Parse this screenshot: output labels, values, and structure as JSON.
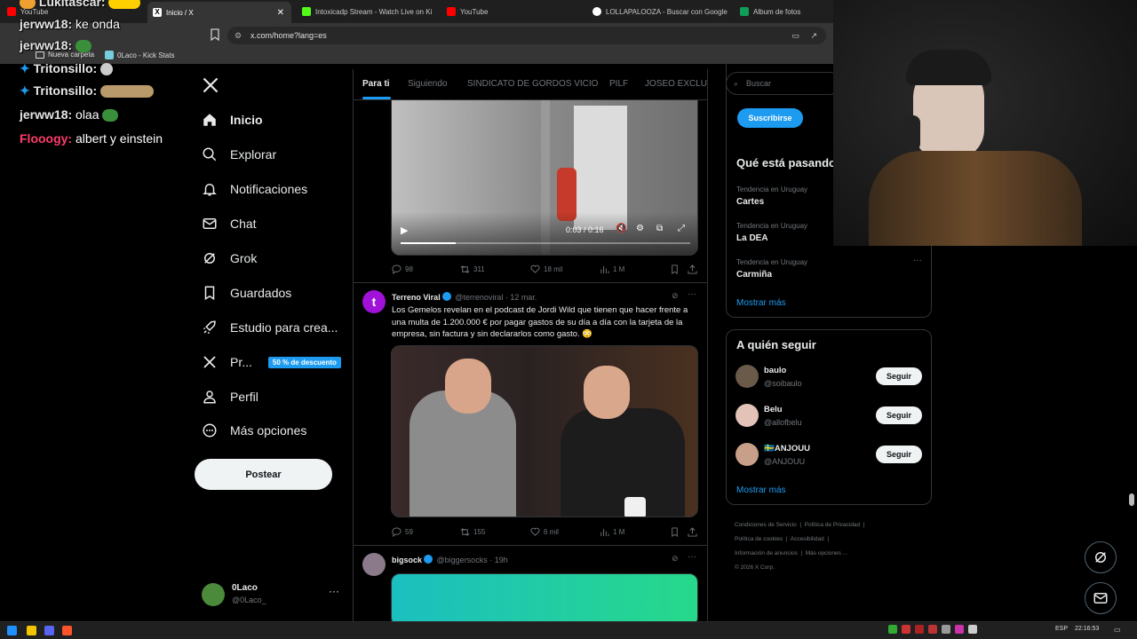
{
  "browser": {
    "tabs": [
      {
        "label": "YouTube",
        "color": "#ff0000"
      },
      {
        "label": "Inicio / X",
        "color": "#ffffff"
      },
      {
        "label": "Intoxicadp Stream - Watch Live on Ki",
        "color": "#53fc18"
      },
      {
        "label": "YouTube",
        "color": "#ff0000"
      },
      {
        "label": "LOLLAPALOOZA - Buscar con Google",
        "color": "#4285f4"
      },
      {
        "label": "Album de fotos",
        "color": "#0f9d58"
      }
    ],
    "url": "x.com/home?lang=es",
    "bookmarks": [
      "Nueva carpeta",
      "0Laco - Kick Stats"
    ]
  },
  "chat": [
    {
      "user": "Lukitascar:",
      "message": ""
    },
    {
      "user": "jerww18:",
      "message": "ke onda"
    },
    {
      "user": "jerww18:",
      "message": ""
    },
    {
      "user": "Tritonsillo:",
      "message": ""
    },
    {
      "user": "Tritonsillo:",
      "message": ""
    },
    {
      "user": "jerww18:",
      "message": "olaa"
    },
    {
      "user": "Flooogy:",
      "message": "albert y einstein"
    }
  ],
  "nav": {
    "items": [
      {
        "label": "Inicio",
        "icon": "home-icon"
      },
      {
        "label": "Explorar",
        "icon": "search-icon"
      },
      {
        "label": "Notificaciones",
        "icon": "bell-icon"
      },
      {
        "label": "Chat",
        "icon": "mail-icon"
      },
      {
        "label": "Grok",
        "icon": "grok-icon"
      },
      {
        "label": "Guardados",
        "icon": "bookmark-icon"
      },
      {
        "label": "Estudio para crea...",
        "icon": "rocket-icon"
      },
      {
        "label": "Pr...",
        "icon": "x-icon"
      },
      {
        "label": "Perfil",
        "icon": "person-icon"
      },
      {
        "label": "Más opciones",
        "icon": "more-icon"
      }
    ],
    "promo_badge": "50 % de descuento",
    "post_button": "Postear",
    "account": {
      "name": "0Laco",
      "handle": "@0Laco_"
    }
  },
  "feed": {
    "tabs": [
      "Para ti",
      "Siguiendo",
      "SINDICATO DE GORDOS VICIO",
      "PILF",
      "JOSEO EXCLUSI"
    ],
    "video1": {
      "time": "0:03 / 0:16",
      "progress": 0.19
    },
    "tweet1_stats": {
      "replies": "98",
      "reposts": "311",
      "likes": "18 mil",
      "views": "1 M"
    },
    "tweet2": {
      "name": "Terreno Viral",
      "handle": "@terrenoviral",
      "date": "· 12 mar.",
      "text": "Los Gemelos revelan en el podcast de Jordi Wild que tienen que hacer frente a una multa de 1.200.000 € por pagar gastos de su día a día con la tarjeta de la empresa, sin factura y sin declararlos como gasto. 😳",
      "stats": {
        "replies": "59",
        "reposts": "155",
        "likes": "6 mil",
        "views": "1 M"
      }
    },
    "tweet3": {
      "name": "bigsock",
      "handle": "@biggersocks",
      "date": "· 19h"
    }
  },
  "sidebar": {
    "search_placeholder": "Buscar",
    "subscribe": "Suscribirse",
    "trends_title": "Qué está pasando",
    "trends": [
      {
        "category": "Tendencia en Uruguay",
        "name": "Cartes"
      },
      {
        "category": "Tendencia en Uruguay",
        "name": "La DEA"
      },
      {
        "category": "Tendencia en Uruguay",
        "name": "Carmiña"
      }
    ],
    "show_more": "Mostrar más",
    "follow_title": "A quién seguir",
    "follow": [
      {
        "name": "baulo",
        "handle": "@soibaulo",
        "button": "Seguir"
      },
      {
        "name": "Belu",
        "handle": "@allofbelu",
        "button": "Seguir"
      },
      {
        "name": "🇸🇪ANJOUU",
        "handle": "@ANJOUU",
        "button": "Seguir"
      }
    ],
    "show_more_2": "Mostrar más",
    "footer": [
      "Condiciones de Servicio",
      "Política de Privacidad",
      "Política de cookies",
      "Accesibilidad",
      "Información de anuncios",
      "Más opciones ...",
      "© 2026 X Corp."
    ]
  },
  "taskbar": {
    "lang": "ESP",
    "time": "22:16:53"
  }
}
